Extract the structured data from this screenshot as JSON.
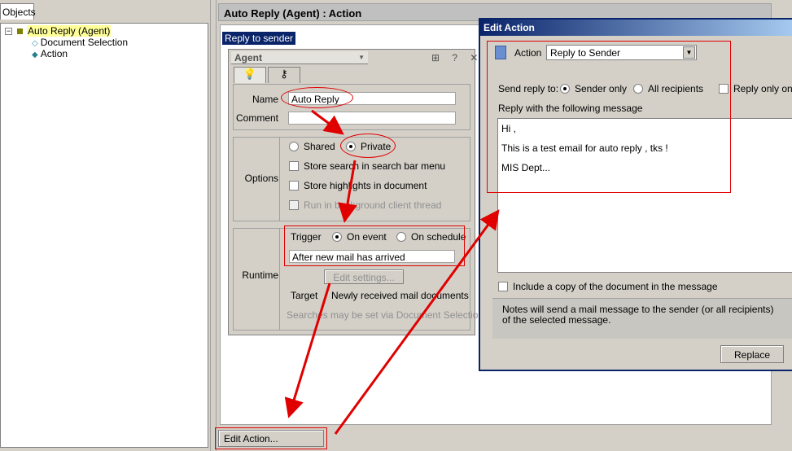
{
  "left_tab": "Objects",
  "tree": {
    "root": "Auto Reply (Agent)",
    "children": [
      "Document Selection",
      "Action"
    ]
  },
  "right_header": "Auto Reply (Agent) : Action",
  "selected_text": "Reply to sender",
  "agent_panel": {
    "title": "Agent",
    "controls": "⊞ ? ✕",
    "name_label": "Name",
    "name_value": "Auto Reply",
    "comment_label": "Comment",
    "comment_value": "",
    "options_label": "Options",
    "shared": "Shared",
    "private": "Private",
    "store_search": "Store search in search bar menu",
    "store_highlights": "Store highlights in document",
    "run_background": "Run in background client thread",
    "runtime_label": "Runtime",
    "trigger_label": "Trigger",
    "on_event": "On event",
    "on_schedule": "On schedule",
    "trigger_event": "After new mail has arrived",
    "edit_settings": "Edit settings...",
    "target_label": "Target",
    "target_value": "Newly received mail documents",
    "searches_note": "Searches may be set via Document Selection"
  },
  "edit_action_button": "Edit Action...",
  "dialog": {
    "title": "Edit Action",
    "action_label": "Action",
    "action_value": "Reply to Sender",
    "send_reply_label": "Send reply to:",
    "sender_only": "Sender only",
    "all_recipients": "All recipients",
    "reply_once": "Reply only once",
    "message_label": "Reply with the following message",
    "message_lines": [
      "Hi ,",
      "This is a test email for auto reply , tks !",
      "MIS Dept..."
    ],
    "include_copy": "Include a copy of the document in the message",
    "info_text": "Notes will send a mail message to the sender (or all recipients) of the selected message.",
    "replace_button": "Replace"
  },
  "colors": {
    "annotation": "#e00000",
    "selection": "#0a246a",
    "title_bar": "#0a246a"
  }
}
